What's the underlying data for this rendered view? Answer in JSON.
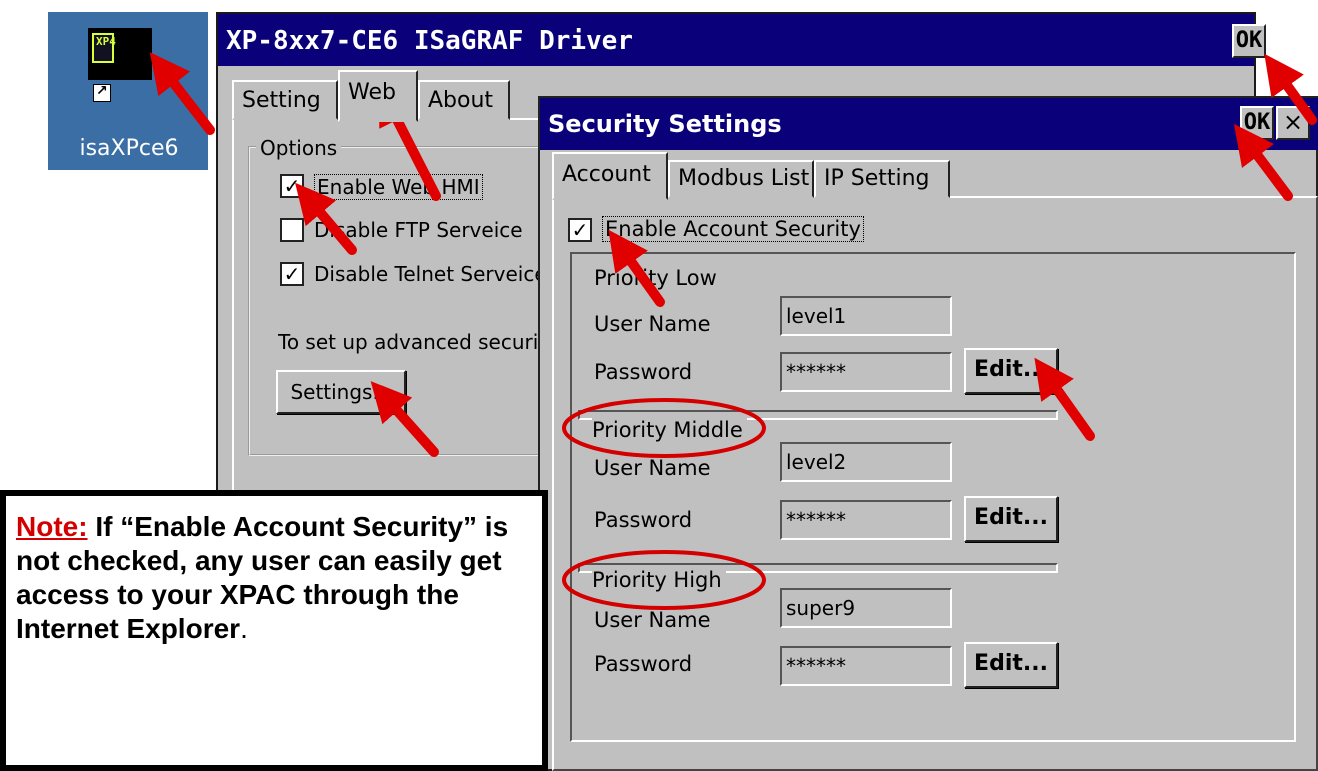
{
  "desktop": {
    "icon_label": "isaXPce6",
    "icon_glyph": "XP4",
    "icon_name": "isagraf-app-icon"
  },
  "driver_window": {
    "title": "XP-8xx7-CE6 ISaGRAF Driver",
    "ok_label": "OK",
    "tabs": [
      {
        "label": "Setting"
      },
      {
        "label": "Web"
      },
      {
        "label": "About"
      }
    ],
    "active_tab": "Web",
    "options_legend": "Options",
    "checkboxes": [
      {
        "label": "Enable Web HMI",
        "checked": true
      },
      {
        "label": "Disable FTP Serveice",
        "checked": false
      },
      {
        "label": "Disable Telnet Serveice",
        "checked": true
      }
    ],
    "advanced_text": "To set up advanced securit",
    "settings_button": "Settings..."
  },
  "security_window": {
    "title": "Security Settings",
    "ok_label": "OK",
    "close_label": "×",
    "tabs": [
      {
        "label": "Account"
      },
      {
        "label": "Modbus List"
      },
      {
        "label": "IP Setting"
      }
    ],
    "active_tab": "Account",
    "enable_account": {
      "label": "Enable Account Security",
      "checked": true
    },
    "priorities": [
      {
        "heading": "Priority Low",
        "user_label": "User Name",
        "user_value": "level1",
        "pass_label": "Password",
        "pass_value": "******",
        "edit_label": "Edit..."
      },
      {
        "heading": "Priority Middle",
        "user_label": "User Name",
        "user_value": "level2",
        "pass_label": "Password",
        "pass_value": "******",
        "edit_label": "Edit..."
      },
      {
        "heading": "Priority High",
        "user_label": "User Name",
        "user_value": "super9",
        "pass_label": "Password",
        "pass_value": "******",
        "edit_label": "Edit..."
      }
    ]
  },
  "note": {
    "prefix": "Note:",
    "text": " If “Enable Account Security” is not checked, any user can easily get access to your XPAC through the Internet Explorer",
    "suffix": "."
  },
  "colors": {
    "title_bar": "#0a007a",
    "window_face": "#c0c0c0",
    "arrow": "#e00000",
    "desktop": "#3a6ea5"
  }
}
